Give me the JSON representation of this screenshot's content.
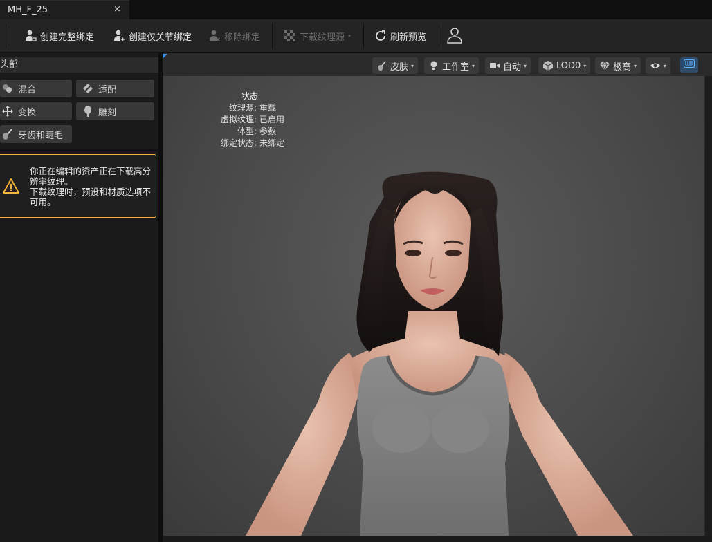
{
  "tab": {
    "title": "MH_F_25",
    "close": "×"
  },
  "toolbar": {
    "create_full_rig": "创建完整绑定",
    "create_joint_rig": "创建仅关节绑定",
    "remove_rig": "移除绑定",
    "download_texture_source": "下载纹理源",
    "download_indicator": "•",
    "refresh_preview": "刷新预览"
  },
  "left_panel": {
    "section_title": "头部",
    "tools": {
      "blend": "混合",
      "fit": "适配",
      "transform": "变换",
      "sculpt": "雕刻",
      "teeth_lashes": "牙齿和睫毛"
    },
    "warning": {
      "line1": "你正在编辑的资产正在下载高分辨率纹理。",
      "line2": "下载纹理时，预设和材质选项不可用。"
    }
  },
  "viewport_toolbar": {
    "skin": "皮肤",
    "studio": "工作室",
    "auto": "自动",
    "lod": "LOD0",
    "quality": "极高"
  },
  "status": {
    "title": "状态",
    "rows": [
      {
        "label": "纹理源:",
        "value": "重载"
      },
      {
        "label": "虚拟纹理:",
        "value": "已启用"
      },
      {
        "label": "体型:",
        "value": "参数"
      },
      {
        "label": "绑定状态:",
        "value": "未绑定"
      }
    ]
  },
  "colors": {
    "warning_border": "#f0b43c",
    "accent_blue": "#3b8fe8",
    "panel_bg": "#1a1a1a"
  }
}
